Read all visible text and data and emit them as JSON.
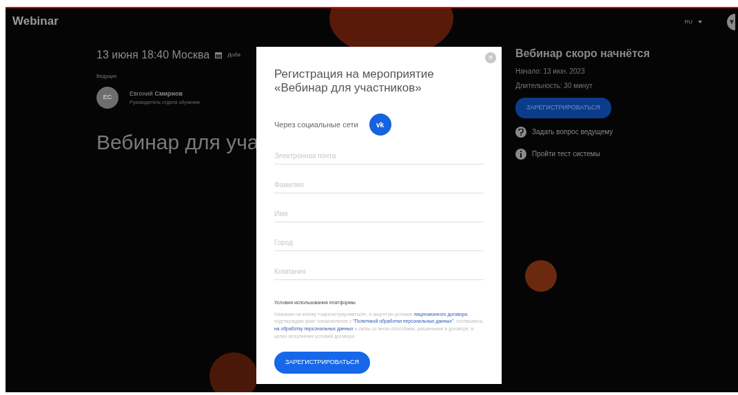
{
  "header": {
    "logo": "Webinar",
    "language": "RU"
  },
  "event": {
    "datetime": "13 июня 18:40 Москва",
    "calendar_link": "Доба",
    "presenters_label": "Ведущие",
    "presenter": {
      "initials": "ЕС",
      "first_name": "Евгений",
      "last_name": "Смирнов",
      "role": "Руководитель отдела обучения"
    },
    "title": "Вебинар для уча"
  },
  "status": {
    "title": "Вебинар скоро начнётся",
    "start": "Начало: 13 июн. 2023",
    "duration": "Длительность: 30 минут",
    "register_button": "ЗАРЕГИСТРИРОВАТЬСЯ",
    "links": [
      {
        "kind": "question",
        "label": "Задать вопрос ведущему"
      },
      {
        "kind": "info",
        "label": "Пройти тест системы"
      }
    ]
  },
  "modal": {
    "close": "×",
    "title": "Регистрация на мероприятие «Вебинар для участников»",
    "social_label": "Через социальные сети",
    "social_button": "vk",
    "fields": [
      {
        "placeholder": "Электронная почта"
      },
      {
        "placeholder": "Фамилия"
      },
      {
        "placeholder": "Имя"
      },
      {
        "placeholder": "Город"
      },
      {
        "placeholder": "Компания"
      }
    ],
    "terms_title": "Условия использования платформы",
    "terms": [
      {
        "kind": "text",
        "text": "Нажимая на кнопку «зарегистрироваться», я акцептую условия "
      },
      {
        "kind": "link",
        "text": "лицензионного договора"
      },
      {
        "kind": "text",
        "text": ", подтверждаю факт ознакомления с "
      },
      {
        "kind": "link",
        "text": "\"Политикой обработки персональных данных\""
      },
      {
        "kind": "text",
        "text": ", соглашаюсь "
      },
      {
        "kind": "link",
        "text": "на обработку персональных данных"
      },
      {
        "kind": "text",
        "text": " и связь со мною способами, указанными в договоре, в целях исполнения условий договора."
      }
    ],
    "submit": "ЗАРЕГИСТРИРОВАТЬСЯ"
  }
}
